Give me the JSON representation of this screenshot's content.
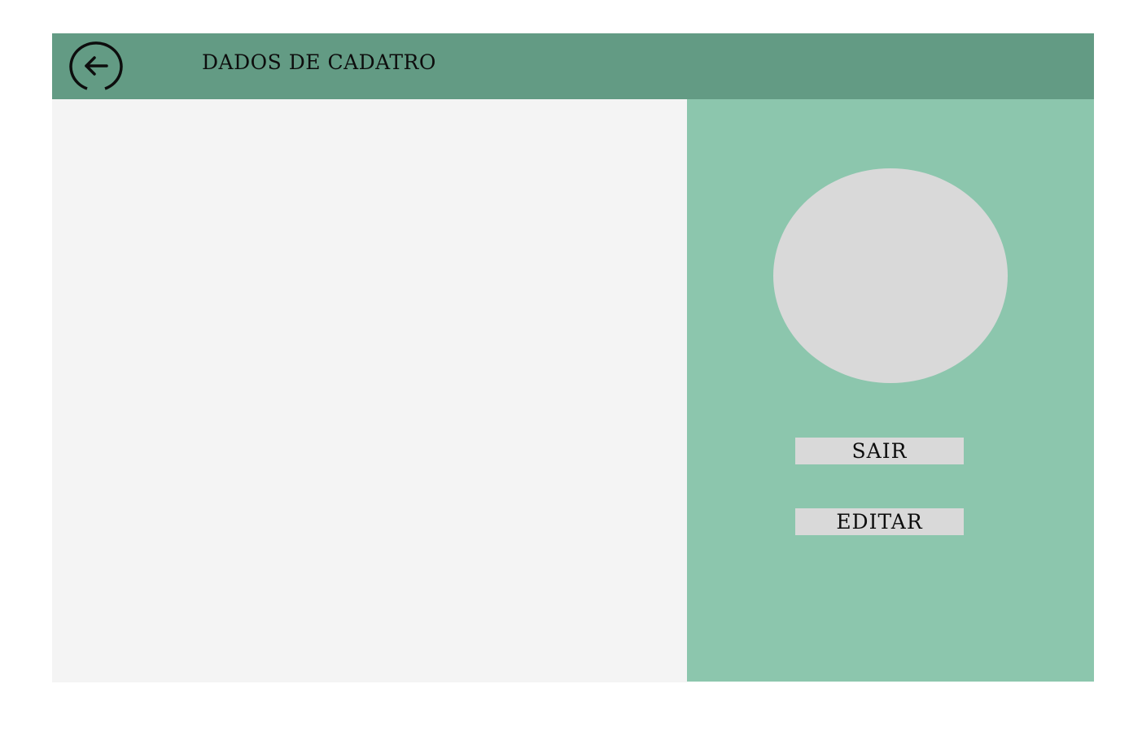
{
  "header": {
    "title": "DADOS DE CADATRO",
    "back_icon": "arrow-left-circle-icon"
  },
  "profile": {
    "avatar_icon": "avatar-placeholder"
  },
  "actions": {
    "sair_label": "SAIR",
    "editar_label": "EDITAR"
  },
  "colors": {
    "header": "#639b84",
    "side_panel": "#8cc6ad",
    "main_panel": "#f4f4f4",
    "placeholder": "#d9d9d9"
  }
}
